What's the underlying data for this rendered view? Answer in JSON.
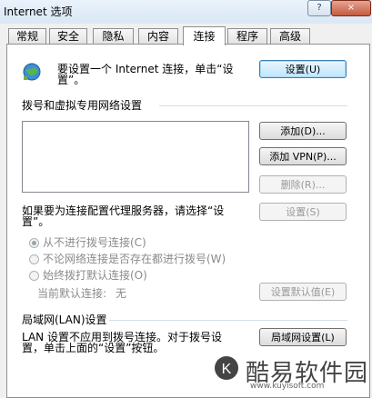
{
  "window": {
    "title": "Internet 选项",
    "help_label": "?",
    "close_label": "×"
  },
  "tabs": [
    {
      "label": "常规"
    },
    {
      "label": "安全"
    },
    {
      "label": "隐私"
    },
    {
      "label": "内容"
    },
    {
      "label": "连接"
    },
    {
      "label": "程序"
    },
    {
      "label": "高级"
    }
  ],
  "active_tab": "连接",
  "setup": {
    "icon": "internet-globe-icon",
    "text_line1": "要设置一个 Internet 连接，单击“设",
    "text_line2": "置”。",
    "button": "设置(U)"
  },
  "dialup": {
    "heading": "拨号和虚拟专用网络设置",
    "add_button": "添加(D)...",
    "add_vpn_button": "添加 VPN(P)...",
    "remove_button": "删除(R)...",
    "settings_button": "设置(S)",
    "proxy_text_line1": "如果要为连接配置代理服务器，请选择“设",
    "proxy_text_line2": "置”。",
    "options": [
      {
        "label": "从不进行拨号连接(C)",
        "checked": true
      },
      {
        "label": "不论网络连接是否存在都进行拨号(W)",
        "checked": false
      },
      {
        "label": "始终拨打默认连接(O)",
        "checked": false
      }
    ],
    "current_default_label": "当前默认连接:",
    "current_default_value": "无",
    "set_default_button": "设置默认值(E)"
  },
  "lan": {
    "heading": "局域网(LAN)设置",
    "text_line1": "LAN 设置不应用到拨号连接。对于拨号设",
    "text_line2": "置，单击上面的“设置”按钮。",
    "button": "局域网设置(L)"
  },
  "watermark": {
    "logo_letter": "K",
    "name": "酷易软件园",
    "url": "www.kuyisoft.com"
  }
}
